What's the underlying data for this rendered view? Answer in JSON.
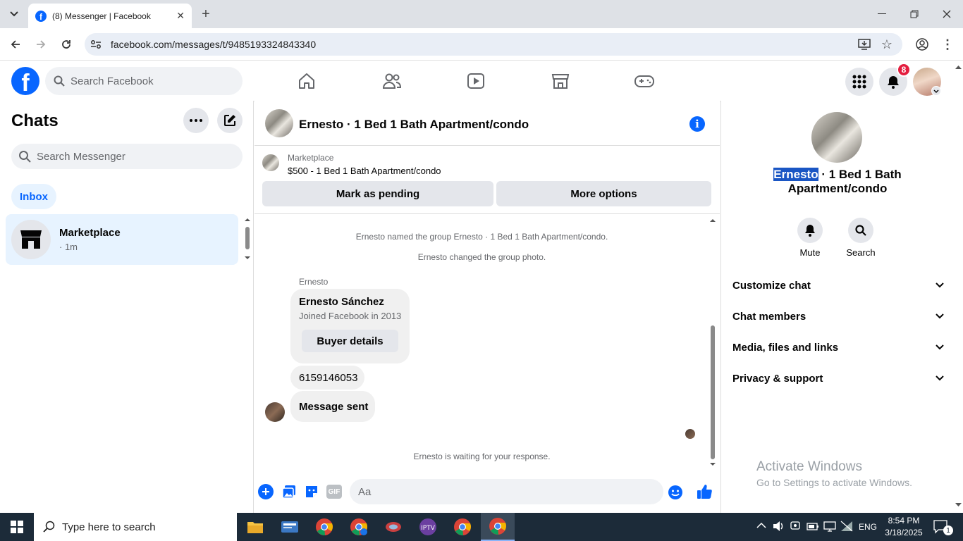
{
  "browser": {
    "tab_title": "(8) Messenger | Facebook",
    "url": "facebook.com/messages/t/9485193324843340"
  },
  "fb_header": {
    "search_placeholder": "Search Facebook",
    "notification_count": "8"
  },
  "left": {
    "title": "Chats",
    "search_placeholder": "Search Messenger",
    "filter_label": "Inbox",
    "conversations": [
      {
        "name": "Marketplace",
        "time": "· 1m"
      }
    ]
  },
  "chat": {
    "header_title": "Ernesto · 1 Bed 1 Bath Apartment/condo",
    "marketplace_label": "Marketplace",
    "listing": "$500 - 1 Bed 1 Bath Apartment/condo",
    "mark_pending": "Mark as pending",
    "more_options": "More options",
    "system_1": "Ernesto named the group Ernesto · 1 Bed 1 Bath Apartment/condo.",
    "system_2": "Ernesto changed the group photo.",
    "sender": "Ernesto",
    "card_name": "Ernesto Sánchez",
    "card_sub": "Joined Facebook in 2013",
    "buyer_details": "Buyer details",
    "msg_phone": "6159146053",
    "msg_sent": "Message sent",
    "waiting": "Ernesto is waiting for your response.",
    "composer_placeholder": "Aa"
  },
  "right": {
    "title_highlight": "Ernesto",
    "title_rest": " · 1 Bed 1 Bath Apartment/condo",
    "mute": "Mute",
    "search": "Search",
    "sections": [
      "Customize chat",
      "Chat members",
      "Media, files and links",
      "Privacy & support"
    ]
  },
  "watermark": {
    "line1": "Activate Windows",
    "line2": "Go to Settings to activate Windows."
  },
  "taskbar": {
    "search_placeholder": "Type here to search",
    "lang": "ENG",
    "time": "8:54 PM",
    "date": "3/18/2025",
    "notif_count": "1"
  },
  "colors": {
    "fb_blue": "#0866ff",
    "highlight": "#1a56c4",
    "taskbar": "#1c2b39"
  }
}
